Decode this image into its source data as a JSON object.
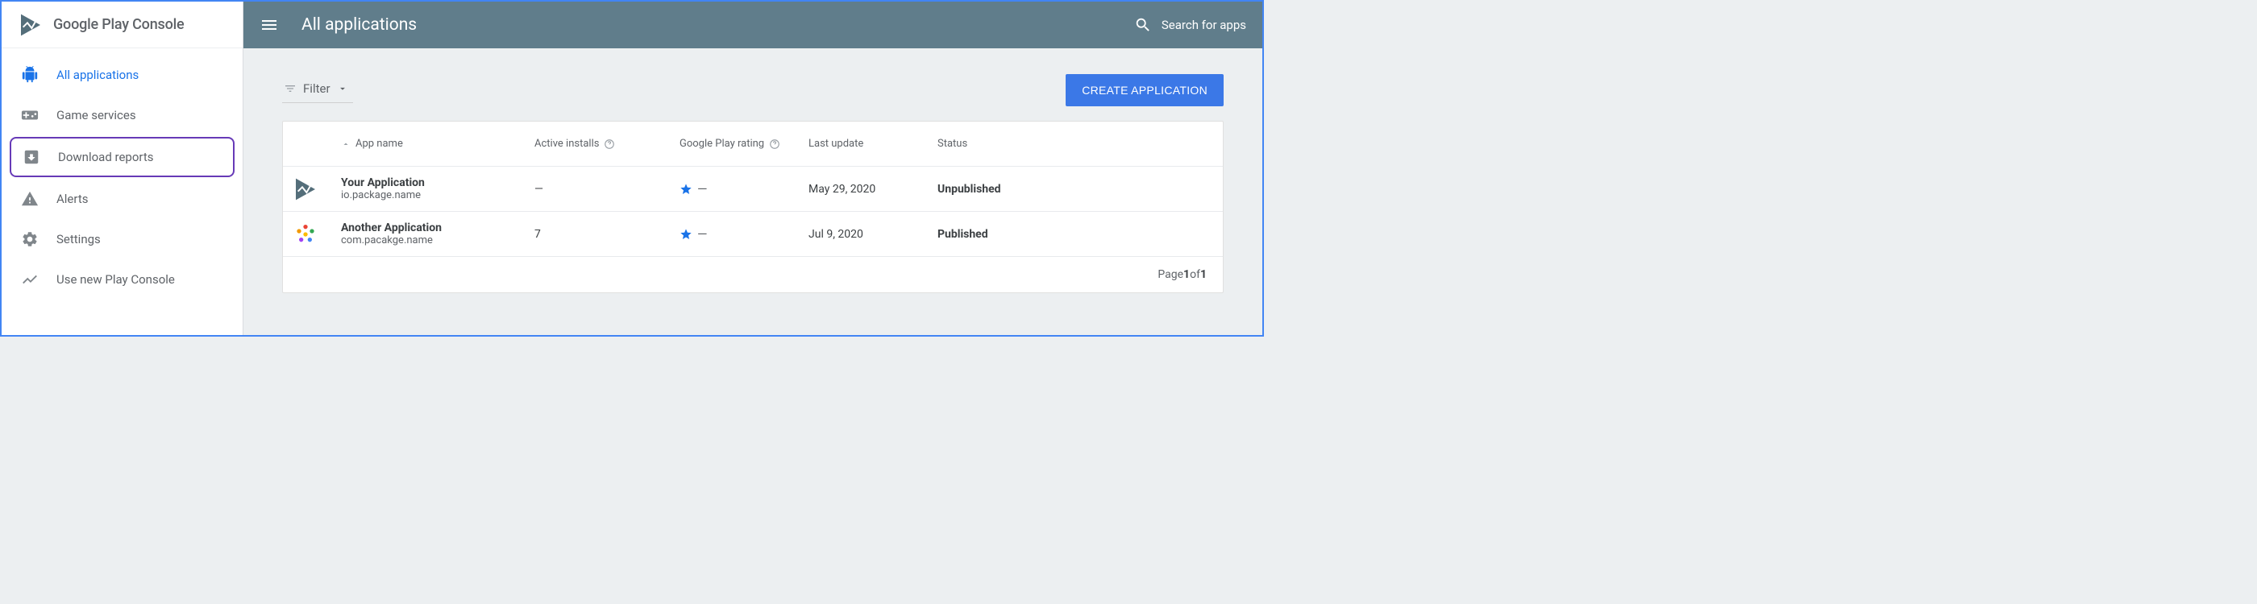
{
  "brand": {
    "name": "Google Play Console"
  },
  "sidebar": {
    "items": [
      {
        "label": "All applications",
        "icon": "android-icon",
        "active": true
      },
      {
        "label": "Game services",
        "icon": "gamepad-icon"
      },
      {
        "label": "Download reports",
        "icon": "download-box-icon",
        "highlighted": true
      },
      {
        "label": "Alerts",
        "icon": "warning-icon"
      },
      {
        "label": "Settings",
        "icon": "gear-icon"
      },
      {
        "label": "Use new Play Console",
        "icon": "chart-line-icon"
      }
    ]
  },
  "header": {
    "title": "All applications",
    "search_label": "Search for apps"
  },
  "toolbar": {
    "filter_label": "Filter",
    "create_label": "CREATE APPLICATION"
  },
  "table": {
    "columns": {
      "app_name": "App name",
      "active_installs": "Active installs",
      "rating": "Google Play rating",
      "last_update": "Last update",
      "status": "Status"
    },
    "rows": [
      {
        "name": "Your Application",
        "package": "io.package.name",
        "active_installs": "—",
        "rating": "—",
        "last_update": "May 29, 2020",
        "status": "Unpublished",
        "icon_kind": "play"
      },
      {
        "name": "Another Application",
        "package": "com.pacakge.name",
        "active_installs": "7",
        "rating": "—",
        "last_update": "Jul 9, 2020",
        "status": "Published",
        "icon_kind": "color-burst"
      }
    ]
  },
  "pager": {
    "prefix": "Page ",
    "current": "1",
    "of": " of ",
    "total": "1"
  }
}
